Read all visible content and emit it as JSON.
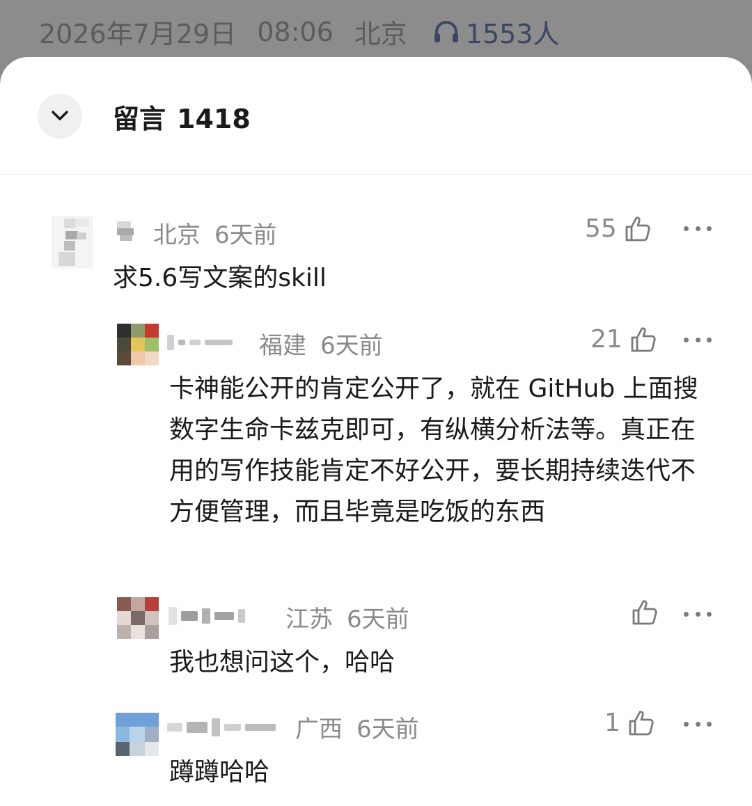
{
  "top_meta": {
    "date": "2026年7月29日",
    "time": "08:06",
    "location": "北京",
    "listen_count": "1553人"
  },
  "header": {
    "title": "留言",
    "count": "1418"
  },
  "comments": [
    {
      "location": "北京",
      "time": "6天前",
      "likes": "55",
      "content": "求5.6写文案的skill"
    },
    {
      "location": "福建",
      "time": "6天前",
      "likes": "21",
      "content": "卡神能公开的肯定公开了，就在 GitHub 上面搜数字生命卡兹克即可，有纵横分析法等。真正在用的写作技能肯定不好公开，要长期持续迭代不方便管理，而且毕竟是吃饭的东西"
    },
    {
      "location": "江苏",
      "time": "6天前",
      "likes": "",
      "content": "我也想问这个，哈哈"
    },
    {
      "location": "广西",
      "time": "6天前",
      "likes": "1",
      "content": "蹲蹲哈哈"
    }
  ]
}
